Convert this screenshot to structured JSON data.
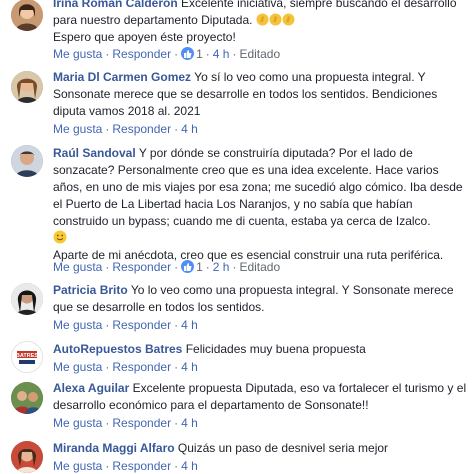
{
  "actions": {
    "like": "Me gusta",
    "reply": "Responder",
    "separator": "·",
    "edited": "Editado"
  },
  "comments": [
    {
      "name": "Irina Román Calderón",
      "text": "Excelente iniciativa, siempre buscando el desarrollo para nuestro departamento Diputada.",
      "text2": "Espero que apoyen éste proyecto!",
      "emoji": "clapping-hands-emoji",
      "likes": "1",
      "time": "4 h"
    },
    {
      "name": "Maria Dl Carmen Gomez",
      "text": "Yo sí lo veo como una propuesta integral. Y Sonsonate merece que se desarrolle en todos los sentidos. Bendiciones diputa vamos 2018 al. 2021",
      "time": "4 h"
    },
    {
      "name": "Raúl Sandoval",
      "text": "Y por dónde se construiría diputada? Por el lado de sonzacate? Personalmente creo que es una idea excelente. Hace varios años, en uno de mis viajes por esa zona; me sucedió algo cómico. Iba desde el Puerto de La Libertad hacia Los Naranjos, y no sabía que habían construido un bypass; cuando me di cuenta, estaba ya cerca de Izalco.",
      "emoji": "smiley-emoji",
      "text2": "Aparte de mi anécdota, creo que es esencial construir una ruta periférica.",
      "likes": "1",
      "time": "2 h"
    },
    {
      "name": "Patricia Brito",
      "text": "Yo lo veo como una propuesta integral. Y Sonsonate merece que se desarrolle en todos los sentidos.",
      "time": "4 h"
    },
    {
      "name": "AutoRepuestos Batres",
      "text": "Felicidades muy buena propuesta",
      "avatar_text": "BATRES",
      "time": "4 h"
    },
    {
      "name": "Alexa Aguilar",
      "text": "Excelente propuesta Diputada, eso va fortalecer el turismo y el desarrollo económico para el departamento de Sonsonate!!",
      "time": "4 h"
    },
    {
      "name": "Miranda Maggi Alfaro",
      "text": "Quizás un paso de desnivel seria mejor",
      "time": "4 h"
    }
  ],
  "colors": {
    "name": "#385898",
    "link": "#4267b2",
    "meta": "#606770",
    "like_badge": "#4f8ef7"
  }
}
